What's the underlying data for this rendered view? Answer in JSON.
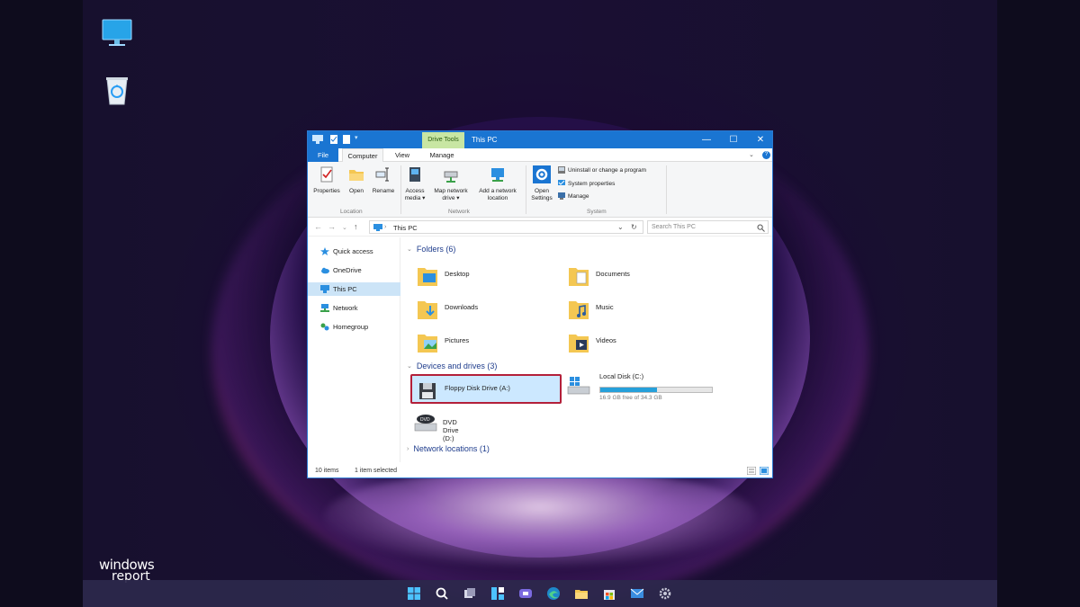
{
  "window": {
    "title": "This PC",
    "contextual_tab": "Drive Tools",
    "controls": {
      "minimize": "—",
      "maximize": "☐",
      "close": "✕"
    }
  },
  "tabs": {
    "file": "File",
    "computer": "Computer",
    "view": "View",
    "manage": "Manage"
  },
  "ribbon": {
    "location": {
      "label": "Location",
      "buttons": [
        {
          "label": "Properties",
          "icon": "properties-icon"
        },
        {
          "label": "Open",
          "icon": "open-icon"
        },
        {
          "label": "Rename",
          "icon": "rename-icon"
        }
      ]
    },
    "network": {
      "label": "Network",
      "buttons": [
        {
          "label1": "Access",
          "label2": "media ▾",
          "icon": "access-media-icon"
        },
        {
          "label1": "Map network",
          "label2": "drive ▾",
          "icon": "map-drive-icon"
        },
        {
          "label1": "Add a network",
          "label2": "location",
          "icon": "network-location-icon"
        }
      ]
    },
    "system": {
      "label": "System",
      "open_settings_1": "Open",
      "open_settings_2": "Settings",
      "items": [
        "Uninstall or change a program",
        "System properties",
        "Manage"
      ]
    }
  },
  "address": {
    "path": "This PC",
    "search_placeholder": "Search This PC"
  },
  "nav_pane": {
    "items": [
      "Quick access",
      "OneDrive",
      "This PC",
      "Network",
      "Homegroup"
    ],
    "selected": "This PC"
  },
  "folders": {
    "header": "Folders (6)",
    "items": [
      "Desktop",
      "Documents",
      "Downloads",
      "Music",
      "Pictures",
      "Videos"
    ]
  },
  "devices": {
    "header": "Devices and drives (3)",
    "floppy": "Floppy Disk Drive (A:)",
    "local_disk": {
      "name": "Local Disk (C:)",
      "free_text": "16.9 GB free of 34.3 GB",
      "used_fraction": 0.51
    },
    "dvd": "DVD Drive (D:)"
  },
  "network_locations": {
    "header": "Network locations (1)"
  },
  "status": {
    "count": "10 items",
    "selected": "1 item selected"
  },
  "watermark": {
    "line1": "windows",
    "line2": "report"
  },
  "colors": {
    "accent": "#1a75d2",
    "highlight_border": "#b3203a",
    "selection": "#cce8ff"
  }
}
